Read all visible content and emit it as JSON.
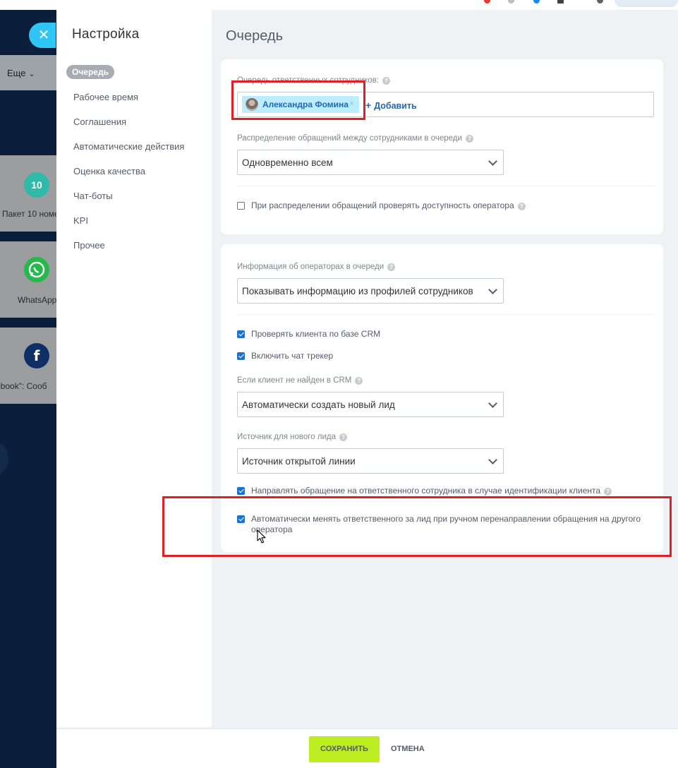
{
  "background": {
    "close_icon": "✕",
    "more_label": "Еще",
    "tiles": [
      {
        "label": "Пакет 10 номе",
        "icon": "package-10-icon",
        "badge": "10",
        "color": "#2fc6b6"
      },
      {
        "label": "WhatsApp",
        "icon": "whatsapp-icon",
        "color": "#25b84c"
      },
      {
        "label": "ebook\": Сооб",
        "icon": "facebook-icon",
        "glyph": "f",
        "color": "#0e2f66"
      }
    ]
  },
  "sidebar": {
    "title": "Настройка",
    "items": [
      {
        "label": "Очередь",
        "active": true
      },
      {
        "label": "Рабочее время"
      },
      {
        "label": "Соглашения"
      },
      {
        "label": "Автоматические действия"
      },
      {
        "label": "Оценка качества"
      },
      {
        "label": "Чат-боты"
      },
      {
        "label": "KPI"
      },
      {
        "label": "Прочее"
      }
    ]
  },
  "main": {
    "title": "Очередь",
    "queue": {
      "label": "Очередь ответственных сотрудников:",
      "user": "Александра Фомина",
      "add_label": "Добавить"
    },
    "distribution": {
      "label": "Распределение обращений между сотрудниками в очереди",
      "value": "Одновременно всем"
    },
    "check_availability": {
      "label": "При распределении обращений проверять доступность оператора",
      "checked": false
    },
    "operator_info": {
      "label": "Информация об операторах в очереди",
      "value": "Показывать информацию из профилей сотрудников"
    },
    "check_crm": {
      "label": "Проверять клиента по базе CRM",
      "checked": true
    },
    "chat_tracker": {
      "label": "Включить чат трекер",
      "checked": true
    },
    "not_found": {
      "label": "Если клиент не найден в CRM",
      "value": "Автоматически создать новый лид"
    },
    "lead_source": {
      "label": "Источник для нового лида",
      "value": "Источник открытой линии"
    },
    "route_responsible": {
      "label": "Направлять обращение на ответственного сотрудника в случае идентификации клиента",
      "checked": true
    },
    "auto_change": {
      "label": "Автоматически менять ответственного за лид при ручном перенаправлении обращения на другого оператора",
      "checked": true
    }
  },
  "footer": {
    "save_label": "СОХРАНИТЬ",
    "cancel_label": "ОТМЕНА"
  },
  "colors": {
    "accent": "#1d72cf",
    "save": "#bbed21",
    "highlight": "#de2026",
    "dark_bg": "#0b1f3d"
  }
}
